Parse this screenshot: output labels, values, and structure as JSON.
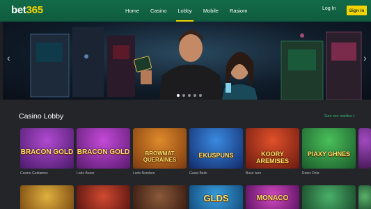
{
  "header": {
    "logo_white": "bet",
    "logo_yellow": "365",
    "nav": [
      "Home",
      "Casino",
      "Lobby",
      "Mobile",
      "Rasiom"
    ],
    "active_nav": "Lobby",
    "login_label": "Log In",
    "signin_label": "Sign in"
  },
  "hero": {
    "arrow_left": "‹",
    "arrow_right": "›",
    "slides": 5,
    "active_slide": 1
  },
  "lobby": {
    "title": "Casino Lobby",
    "see_more": "Sure mor marities  >",
    "games": [
      {
        "title": "BRACON GOLD",
        "label": "Casino Gediames",
        "bg": "#6a2a8a"
      },
      {
        "title": "BRACON GOLD",
        "label": "Lodo Baxer",
        "bg": "#7a2090"
      },
      {
        "title": "BROWMAT QUERAINES",
        "label": "Lodo Nomben",
        "bg": "#b55a1a"
      },
      {
        "title": "EKUSPUNS",
        "label": "Gaasi Bailo",
        "bg": "#1a5aa8"
      },
      {
        "title": "KOORY AREMISES",
        "label": "Buse Ixen",
        "bg": "#a8301a"
      },
      {
        "title": "PIAXY GHNES",
        "label": "Rainx Dofe",
        "bg": "#2a8a3a"
      },
      {
        "title": "",
        "label": "",
        "bg": "#7a2a90"
      }
    ],
    "row2": [
      {
        "title": "",
        "bg": "#c08a1a"
      },
      {
        "title": "",
        "bg": "#9a2a20"
      },
      {
        "title": "",
        "bg": "#6a3a2a"
      },
      {
        "title": "GLDS",
        "bg": "#1a7ab5"
      },
      {
        "title": "MONACO",
        "bg": "#a0208a"
      },
      {
        "title": "",
        "bg": "#2a7a4a"
      },
      {
        "title": "",
        "bg": "#3a8a4a"
      }
    ]
  }
}
